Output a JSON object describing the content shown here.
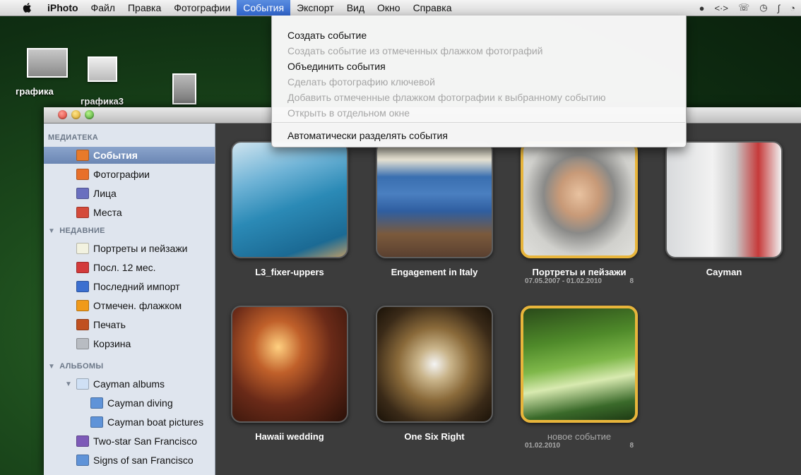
{
  "menubar": {
    "app": "iPhoto",
    "items": [
      "Файл",
      "Правка",
      "Фотографии",
      "События",
      "Экспорт",
      "Вид",
      "Окно",
      "Справка"
    ],
    "active": "События",
    "status_icons": [
      "robot-icon",
      "code-brackets-icon",
      "phone-icon",
      "clock-icon",
      "bluetooth-icon",
      "wifi-icon"
    ]
  },
  "desktop": {
    "icons": [
      {
        "label": "графика"
      },
      {
        "label": "графика3"
      },
      {
        "label": ""
      }
    ]
  },
  "dropdown": {
    "items": [
      {
        "label": "Создать событие",
        "enabled": true
      },
      {
        "label": "Создать событие из отмеченных флажком фотографий",
        "enabled": false
      },
      {
        "label": "Объединить события",
        "enabled": true
      },
      {
        "label": "Сделать фотографию ключевой",
        "enabled": false
      },
      {
        "label": "Добавить отмеченные флажком фотографии к выбранному событию",
        "enabled": false
      },
      {
        "label": "Открыть в отдельном окне",
        "enabled": false
      },
      {
        "label": "Автоматически разделять события",
        "enabled": true
      }
    ]
  },
  "sidebar": {
    "library_header": "МЕДИАТЕКА",
    "library": [
      {
        "label": "События",
        "icon": "events-icon",
        "color": "#e87a2a"
      },
      {
        "label": "Фотографии",
        "icon": "photos-icon",
        "color": "#e8702a"
      },
      {
        "label": "Лица",
        "icon": "faces-icon",
        "color": "#6a6fbf"
      },
      {
        "label": "Места",
        "icon": "places-icon",
        "color": "#d44a3a"
      }
    ],
    "recent_header": "НЕДАВНИЕ",
    "recent": [
      {
        "label": "Портреты и пейзажи",
        "icon": "event-icon",
        "color": "#f2f2e0"
      },
      {
        "label": "Посл. 12 мес.",
        "icon": "calendar-icon",
        "color": "#d33a3a"
      },
      {
        "label": "Последний импорт",
        "icon": "import-icon",
        "color": "#3b6fd0"
      },
      {
        "label": "Отмечен. флажком",
        "icon": "flag-icon",
        "color": "#f09a1a"
      },
      {
        "label": "Печать",
        "icon": "printer-icon",
        "color": "#c05020"
      },
      {
        "label": "Корзина",
        "icon": "trash-icon",
        "color": "#b8bcc2"
      }
    ],
    "albums_header": "АЛЬБОМЫ",
    "albums": [
      {
        "label": "Cayman albums",
        "icon": "folder-icon",
        "color": "#cfe0f5"
      },
      {
        "label": "Cayman diving",
        "icon": "album-icon",
        "color": "#5f93d8"
      },
      {
        "label": "Cayman boat pictures",
        "icon": "album-icon",
        "color": "#5f93d8"
      },
      {
        "label": "Two-star San Francisco",
        "icon": "smart-album-icon",
        "color": "#7d5ab8"
      },
      {
        "label": "Signs of san Francisco",
        "icon": "album-icon",
        "color": "#5f93d8"
      }
    ]
  },
  "events": [
    {
      "title": "L3_fixer-uppers",
      "date": "",
      "count": "",
      "highlight": false
    },
    {
      "title": "Engagement in Italy",
      "date": "",
      "count": "",
      "highlight": false
    },
    {
      "title": "Портреты и пейзажи",
      "date": "07.05.2007 - 01.02.2010",
      "count": "8",
      "highlight": true
    },
    {
      "title": "Cayman",
      "date": "",
      "count": "",
      "highlight": false
    },
    {
      "title": "Hawaii wedding",
      "date": "",
      "count": "",
      "highlight": false
    },
    {
      "title": "One Six Right",
      "date": "",
      "count": "",
      "highlight": false
    },
    {
      "title": "новое событие",
      "date": "01.02.2010",
      "count": "8",
      "highlight": true
    }
  ]
}
